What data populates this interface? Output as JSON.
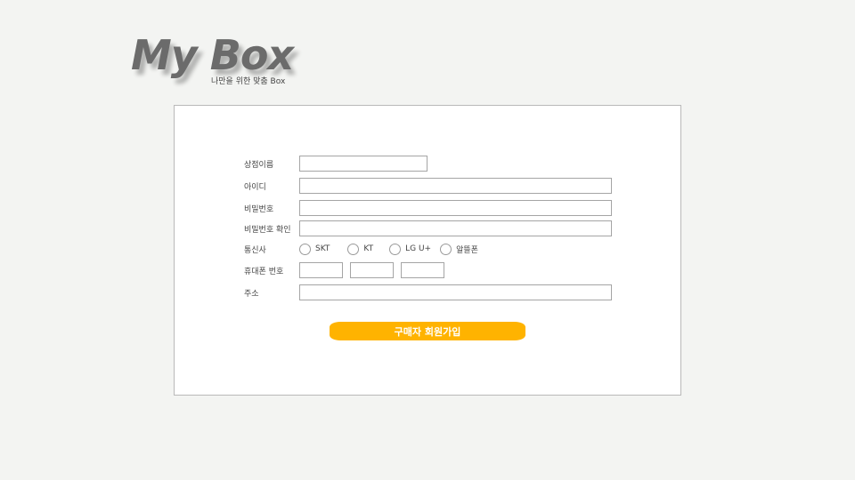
{
  "brand": {
    "logo_text": "My Box",
    "tagline": "나만을 위한 맞춤 Box"
  },
  "form": {
    "store_name_label": "상점이름",
    "id_label": "아이디",
    "password_label": "비밀번호",
    "password_confirm_label": "비밀번호 확인",
    "carrier_label": "통신사",
    "carriers": [
      "SKT",
      "KT",
      "LG U+",
      "알뜰폰"
    ],
    "phone_label": "휴대폰 번호",
    "address_label": "주소",
    "submit_label": "구매자 회원가입"
  },
  "colors": {
    "background": "#f3f4f2",
    "submit_button": "#ffb300",
    "logo_text": "#6b6b6b"
  }
}
